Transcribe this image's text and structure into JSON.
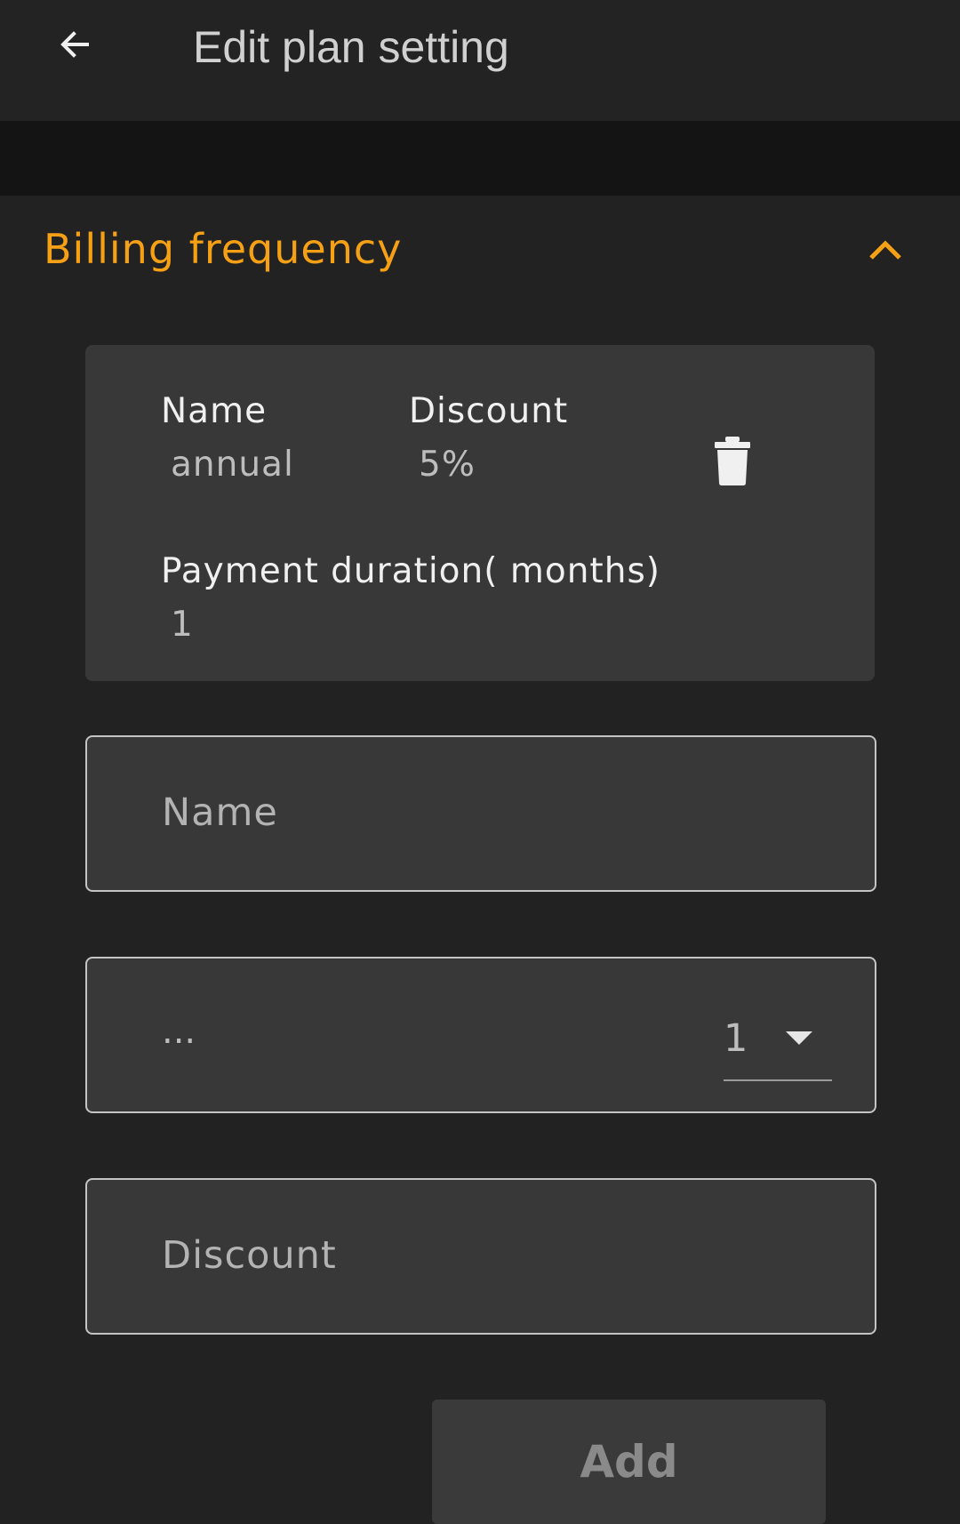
{
  "app_bar": {
    "back_icon": "arrow-left-icon",
    "title": "Edit plan setting"
  },
  "section": {
    "title": "Billing frequency",
    "toggle_icon": "chevron-up-icon",
    "accent_color": "#f5a015",
    "expanded": true
  },
  "entry": {
    "name_label": "Name",
    "name_value": "annual",
    "discount_label": "Discount",
    "discount_value": "5%",
    "duration_label": "Payment duration( months)",
    "duration_value": "1",
    "delete_icon": "trash-icon"
  },
  "form": {
    "name_placeholder": "Name",
    "duration_placeholder": "...",
    "duration_selected": "1",
    "dropdown_icon": "caret-down-icon",
    "discount_placeholder": "Discount",
    "add_label": "Add"
  }
}
